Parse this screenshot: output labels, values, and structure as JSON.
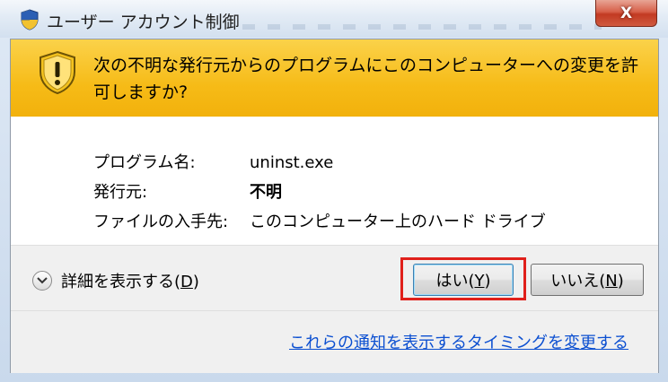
{
  "window": {
    "title": "ユーザー アカウント制御",
    "close_label": "X"
  },
  "banner": {
    "message": "次の不明な発行元からのプログラムにこのコンピューターへの変更を許可しますか?"
  },
  "details": [
    {
      "label": "プログラム名:",
      "value": "uninst.exe"
    },
    {
      "label": "発行元:",
      "value": "不明"
    },
    {
      "label": "ファイルの入手先:",
      "value": "このコンピューター上のハード ドライブ"
    }
  ],
  "footer": {
    "details_toggle": {
      "label": "詳細を表示する(",
      "accel": "D",
      "suffix": ")"
    },
    "yes_button": {
      "label": "はい(",
      "accel": "Y",
      "suffix": ")"
    },
    "no_button": {
      "label": "いいえ(",
      "accel": "N",
      "suffix": ")"
    },
    "notification_link": "これらの通知を表示するタイミングを変更する"
  },
  "colors": {
    "banner": "#f6bb17",
    "highlight": "#e0201b",
    "link": "#0b4fd1"
  }
}
